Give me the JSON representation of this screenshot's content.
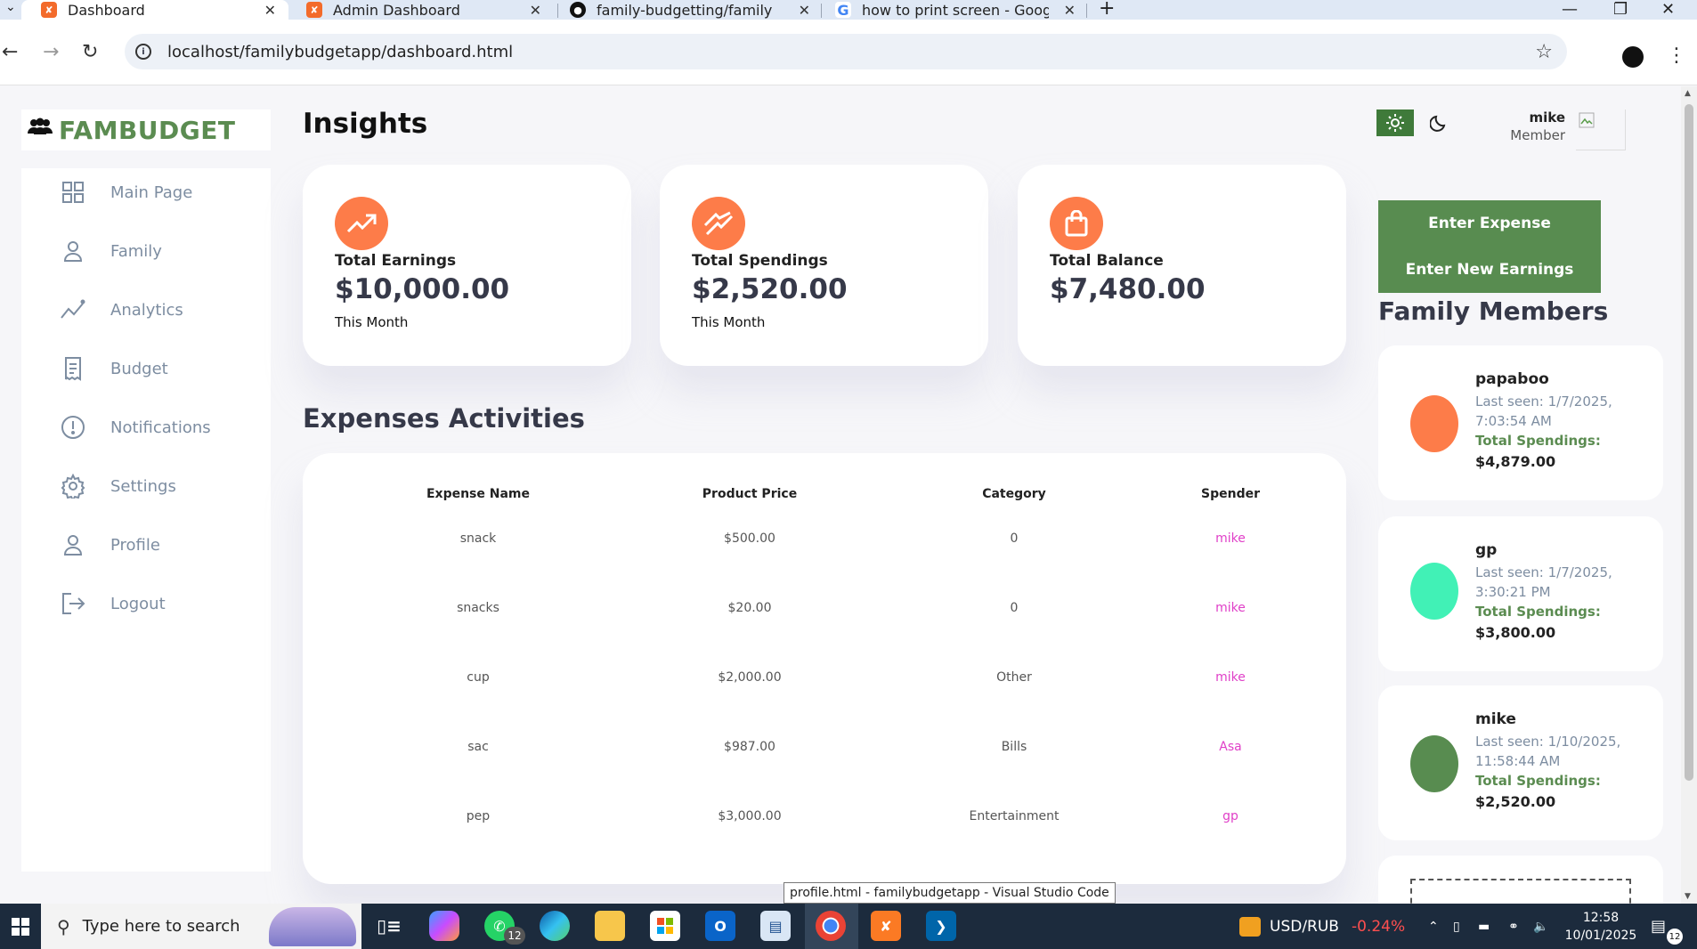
{
  "browser": {
    "tabs": [
      {
        "title": "Dashboard",
        "active": true
      },
      {
        "title": "Admin Dashboard",
        "active": false
      },
      {
        "title": "family-budgetting/family budg",
        "active": false
      },
      {
        "title": "how to print screen - Google Se",
        "active": false
      }
    ],
    "new_tab_label": "+",
    "url": "localhost/familybudgetapp/dashboard.html"
  },
  "app": {
    "logo": "FAMBUDGET",
    "sidebar": [
      {
        "label": "Main Page",
        "icon": "grid-icon"
      },
      {
        "label": "Family",
        "icon": "person-icon"
      },
      {
        "label": "Analytics",
        "icon": "analytics-icon"
      },
      {
        "label": "Budget",
        "icon": "receipt-icon"
      },
      {
        "label": "Notifications",
        "icon": "alert-icon"
      },
      {
        "label": "Settings",
        "icon": "gear-icon"
      },
      {
        "label": "Profile",
        "icon": "person-icon"
      },
      {
        "label": "Logout",
        "icon": "logout-icon"
      }
    ],
    "insights_title": "Insights",
    "cards": [
      {
        "label": "Total Earnings",
        "amount": "$10,000.00",
        "sub": "This Month",
        "icon": "trending-up-icon"
      },
      {
        "label": "Total Spendings",
        "amount": "$2,520.00",
        "sub": "This Month",
        "icon": "spendings-chart-icon"
      },
      {
        "label": "Total Balance",
        "amount": "$7,480.00",
        "sub": "",
        "icon": "shopping-bag-icon"
      }
    ],
    "expenses_title": "Expenses Activities",
    "table": {
      "headers": [
        "Expense Name",
        "Product Price",
        "Category",
        "Spender"
      ],
      "rows": [
        [
          "snack",
          "$500.00",
          "0",
          "mike"
        ],
        [
          "snacks",
          "$20.00",
          "0",
          "mike"
        ],
        [
          "cup",
          "$2,000.00",
          "Other",
          "mike"
        ],
        [
          "sac",
          "$987.00",
          "Bills",
          "Asa"
        ],
        [
          "pep",
          "$3,000.00",
          "Entertainment",
          "gp"
        ]
      ]
    },
    "user": {
      "name": "mike",
      "role": "Member"
    },
    "buttons": {
      "enter_expense": "Enter Expense",
      "enter_earnings": "Enter New Earnings"
    },
    "family_title": "Family Members",
    "members": [
      {
        "name": "papaboo",
        "seen_line1": "Last seen: 1/7/2025,",
        "seen_line2": "7:03:54 AM",
        "spend_label": "Total Spendings:",
        "spend_value": "$4,879.00",
        "color": "#fd7c49"
      },
      {
        "name": "gp",
        "seen_line1": "Last seen: 1/7/2025,",
        "seen_line2": "3:30:21 PM",
        "spend_label": "Total Spendings:",
        "spend_value": "$3,800.00",
        "color": "#41f1b6"
      },
      {
        "name": "mike",
        "seen_line1": "Last seen: 1/10/2025,",
        "seen_line2": "11:58:44 AM",
        "spend_label": "Total Spendings:",
        "spend_value": "$2,520.00",
        "color": "#588c50"
      }
    ]
  },
  "tooltip": "profile.html - familybudgetapp - Visual Studio Code",
  "taskbar": {
    "search_placeholder": "Type here to search",
    "whatsapp_badge": "12",
    "currency": "USD/RUB",
    "currency_change": "-0.24%",
    "time": "12:58",
    "date": "10/01/2025",
    "notif_count": "12"
  },
  "colors": {
    "accent_orange": "#fd7c49",
    "green": "#588c50",
    "spender_pink": "#e040c8"
  }
}
